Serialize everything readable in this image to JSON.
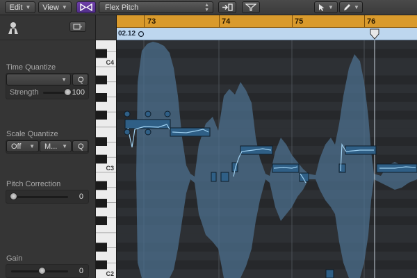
{
  "toolbar": {
    "edit_label": "Edit",
    "view_label": "View",
    "mode_label": "Flex Pitch"
  },
  "ruler": {
    "bars": [
      "73",
      "74",
      "75",
      "76"
    ]
  },
  "timebar": {
    "position": "02.12"
  },
  "inspector": {
    "time_quantize": {
      "title": "Time Quantize",
      "value": "",
      "q_label": "Q",
      "strength_label": "Strength",
      "strength_value": "100",
      "strength_level": 1.0
    },
    "scale_quantize": {
      "title": "Scale Quantize",
      "value": "Off",
      "mode_value": "M...",
      "q_label": "Q"
    },
    "pitch_correction": {
      "title": "Pitch Correction",
      "value": "0",
      "level": 0.0
    },
    "gain": {
      "title": "Gain",
      "value": "0",
      "level": 0.5
    }
  },
  "piano": {
    "octave_labels": [
      "C4",
      "C3",
      "C2"
    ]
  },
  "colors": {
    "ruler": "#d99a2c",
    "timebar": "#bdd6ee",
    "note": "#2f5f86",
    "waveform": "#4c6f8e",
    "mode_active": "#6e3fa8"
  }
}
